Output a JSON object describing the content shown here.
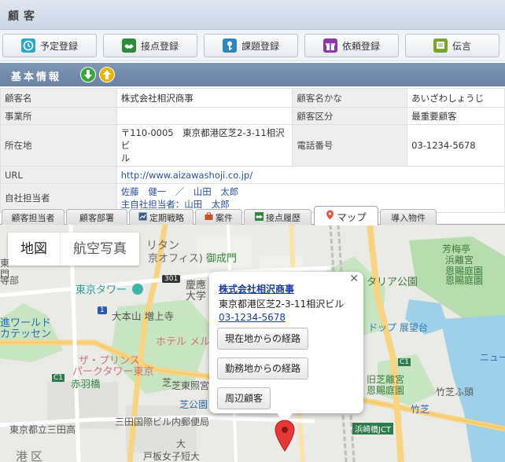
{
  "header": {
    "title": "顧客"
  },
  "actions": [
    {
      "label": "予定登録",
      "icon": "clock-icon",
      "color": "#2ca7c9"
    },
    {
      "label": "接点登録",
      "icon": "handshake-icon",
      "color": "#2f8a3a"
    },
    {
      "label": "課題登録",
      "icon": "key-icon",
      "color": "#2e86c1"
    },
    {
      "label": "依頼登録",
      "icon": "gift-icon",
      "color": "#8a3aa8"
    },
    {
      "label": "伝言",
      "icon": "memo-icon",
      "color": "#7aa32a"
    }
  ],
  "section": {
    "title": "基本情報"
  },
  "info": {
    "name_label": "顧客名",
    "name_value": "株式会社相沢商事",
    "kana_label": "顧客名かな",
    "kana_value": "あいざわしょうじ",
    "office_label": "事業所",
    "office_value": "",
    "class_label": "顧客区分",
    "class_value": "最重要顧客",
    "address_label": "所在地",
    "address_line1": "〒110-0005　東京都港区芝2-3-11相沢ビ",
    "address_line2": "ル",
    "tel_label": "電話番号",
    "tel_value": "03-1234-5678",
    "url_label": "URL",
    "url_value": "http://www.aizawashoji.co.jp/",
    "staff_label": "自社担当者",
    "staff_line1": "佐藤　健一　／　山田　太郎",
    "staff_line2": "主自社担当者：山田　太郎"
  },
  "tabs": [
    {
      "label": "顧客担当者"
    },
    {
      "label": "顧客部署"
    },
    {
      "label": "定期戦略"
    },
    {
      "label": "案件"
    },
    {
      "label": "接点履歴"
    },
    {
      "label": "マップ",
      "active": true
    },
    {
      "label": "導入物件"
    }
  ],
  "map": {
    "type_map": "地図",
    "type_satellite": "航空写真",
    "labels": {
      "l1": "リタン",
      "l2": "京オフィス)",
      "l3": "御成門",
      "l4": "芳梅亭",
      "l5": "恩賜庭園",
      "l6": "浜離宮",
      "l7": "恩賜庭園",
      "l8": "門",
      "l9": "東京タワー",
      "l10": "慶應",
      "l11": "大学",
      "l12": "大本山 増上寺",
      "l13": "タリア公園",
      "l14": "進ワールド",
      "l15": "カテッセン",
      "l16": "ホテル メル",
      "l17": "ザ・プリンス",
      "l18": "パークタワー東京",
      "l19": "赤羽橋",
      "l20": "芝東照宮",
      "l21": "芝公園",
      "l22": "ドップ 展望台",
      "l23": "旧芝離宮",
      "l24": "恩賜庭園",
      "l25": "ニュー",
      "l26": "竹芝ふ頭",
      "l27": "竹芝",
      "l28": "浜崎橋JCT",
      "l29": "東京都立三田高",
      "l30": "三田国際ビル内郵便局",
      "l31": "港区",
      "l32": "戸板女子短大",
      "l33": "301",
      "l34": "1",
      "l35": "C1",
      "l36": "C1",
      "l37": "等部",
      "l38": "東",
      "l39": "大",
      "l40": "芝"
    },
    "popup": {
      "name": "株式会社相沢商事",
      "address": "東京都港区芝2-3-11相沢ビル",
      "tel": "03-1234-5678",
      "btn_current": "現在地からの経路",
      "btn_office": "勤務地からの経路",
      "btn_nearby": "周辺顧客"
    }
  }
}
